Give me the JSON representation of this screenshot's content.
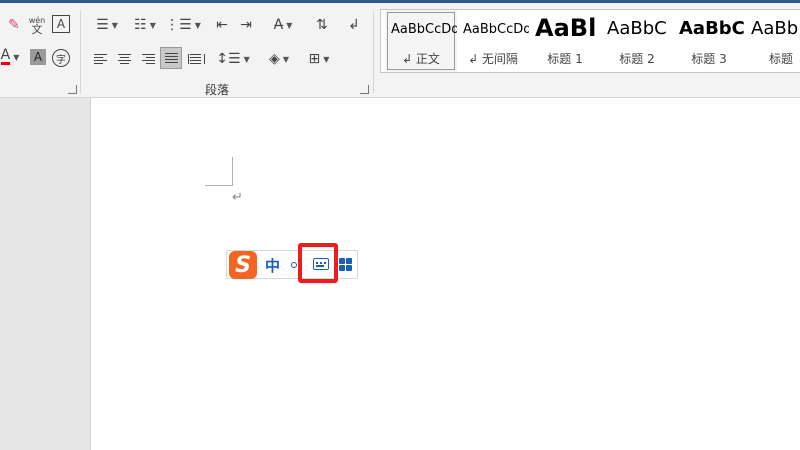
{
  "ribbon": {
    "font_tools": {
      "pinyin_top": "wén",
      "pinyin_bottom": "文",
      "enclose_char": "字"
    },
    "paragraph_group_label": "段落"
  },
  "styles": [
    {
      "preview": "AaBbCcDd",
      "name": "↲ 正文",
      "selected": true
    },
    {
      "preview": "AaBbCcDd",
      "name": "↲ 无间隔",
      "selected": false
    },
    {
      "preview": "AaBl",
      "name": "标题 1",
      "selected": false
    },
    {
      "preview": "AaBbC",
      "name": "标题 2",
      "selected": false
    },
    {
      "preview": "AaBbC",
      "name": "标题 3",
      "selected": false
    },
    {
      "preview": "AaBb",
      "name": "标题",
      "selected": false
    }
  ],
  "document": {
    "paragraph_mark": "↵"
  },
  "ime": {
    "logo": "S",
    "mode": "中",
    "icons": [
      "punctuation-dot-icon",
      "keyboard-icon",
      "toolbox-grid-icon"
    ],
    "accent_color": "#1560bd",
    "logo_color": "#f26522",
    "highlight_color": "#ee1c1c"
  }
}
